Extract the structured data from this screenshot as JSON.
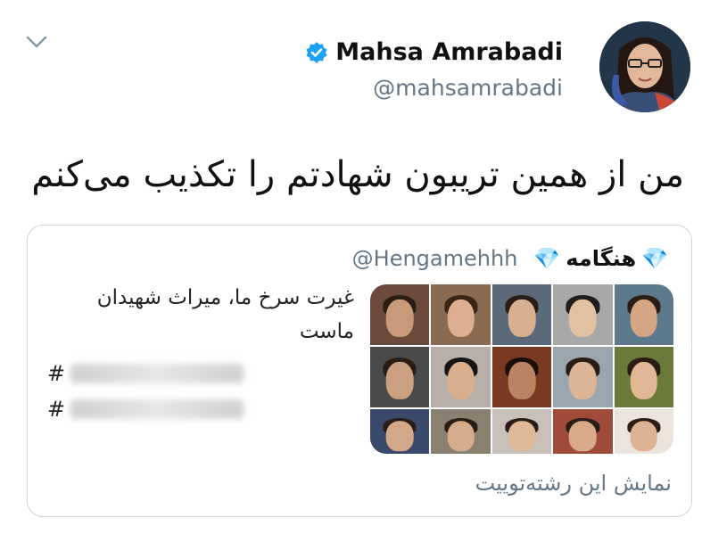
{
  "tweet": {
    "author": {
      "display_name": "Mahsa Amrabadi",
      "handle": "@mahsamrabadi",
      "verified": true
    },
    "text": "من از همین تریبون شهادتم را تکذیب می‌کنم",
    "menu_icon": "chevron-down-icon"
  },
  "quoted_tweet": {
    "author_name": "هنگامه",
    "name_emoji": "💎",
    "handle": "@Hengamehhh",
    "text": "غیرت سرخ ما، میراث شهیدان ماست",
    "hashtags": [
      {
        "prefix": "#",
        "blurred": true
      },
      {
        "prefix": "#",
        "blurred": true
      }
    ],
    "media": {
      "kind": "photo-grid",
      "tiles": 15
    },
    "show_thread": "نمایش این رشته‌توییت"
  },
  "colors": {
    "verified": "#1da1f2",
    "secondary_text": "#657786",
    "border": "#ccd6dd",
    "text": "#111111"
  }
}
